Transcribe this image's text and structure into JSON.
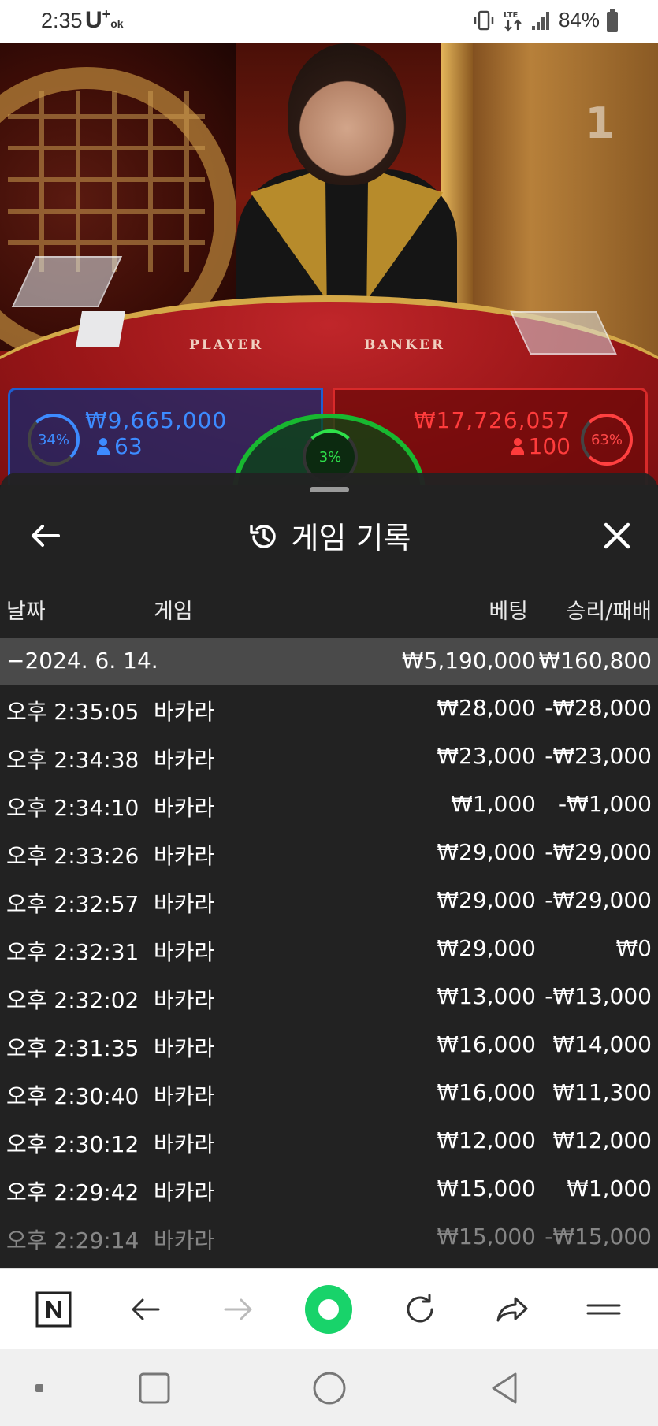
{
  "status_bar": {
    "time": "2:35",
    "carrier": "U",
    "carrier_sup": "+",
    "carrier_sub": "ok",
    "battery_percent": "84%",
    "icons": [
      "vibrate-icon",
      "lte-icon",
      "signal-icon",
      "battery-icon"
    ]
  },
  "video": {
    "table_number": "1",
    "felt_player_label": "PLAYER",
    "felt_banker_label": "BANKER",
    "player_bet": {
      "percent": "34%",
      "amount": "₩9,665,000",
      "count": "63"
    },
    "banker_bet": {
      "percent": "63%",
      "amount": "₩17,726,057",
      "count": "100"
    },
    "tie_bet": {
      "percent": "3%"
    }
  },
  "sheet": {
    "title": "게임 기록",
    "columns": {
      "date": "날짜",
      "game": "게임",
      "bet": "베팅",
      "result": "승리/패배"
    },
    "summary": {
      "date": "−2024. 6. 14.",
      "bet": "₩5,190,000",
      "result": "₩160,800"
    },
    "rows": [
      {
        "time": "오후 2:35:05",
        "game": "바카라",
        "bet": "₩28,000",
        "result": "-₩28,000"
      },
      {
        "time": "오후 2:34:38",
        "game": "바카라",
        "bet": "₩23,000",
        "result": "-₩23,000"
      },
      {
        "time": "오후 2:34:10",
        "game": "바카라",
        "bet": "₩1,000",
        "result": "-₩1,000"
      },
      {
        "time": "오후 2:33:26",
        "game": "바카라",
        "bet": "₩29,000",
        "result": "-₩29,000"
      },
      {
        "time": "오후 2:32:57",
        "game": "바카라",
        "bet": "₩29,000",
        "result": "-₩29,000"
      },
      {
        "time": "오후 2:32:31",
        "game": "바카라",
        "bet": "₩29,000",
        "result": "₩0"
      },
      {
        "time": "오후 2:32:02",
        "game": "바카라",
        "bet": "₩13,000",
        "result": "-₩13,000"
      },
      {
        "time": "오후 2:31:35",
        "game": "바카라",
        "bet": "₩16,000",
        "result": "₩14,000"
      },
      {
        "time": "오후 2:30:40",
        "game": "바카라",
        "bet": "₩16,000",
        "result": "₩11,300"
      },
      {
        "time": "오후 2:30:12",
        "game": "바카라",
        "bet": "₩12,000",
        "result": "₩12,000"
      },
      {
        "time": "오후 2:29:42",
        "game": "바카라",
        "bet": "₩15,000",
        "result": "₩1,000"
      },
      {
        "time": "오후 2:29:14",
        "game": "바카라",
        "bet": "₩15,000",
        "result": "-₩15,000"
      }
    ]
  },
  "colors": {
    "player_blue": "#3d8bff",
    "banker_red": "#ff3c3c",
    "tie_green": "#2ee04a",
    "browser_green": "#18d36a"
  }
}
